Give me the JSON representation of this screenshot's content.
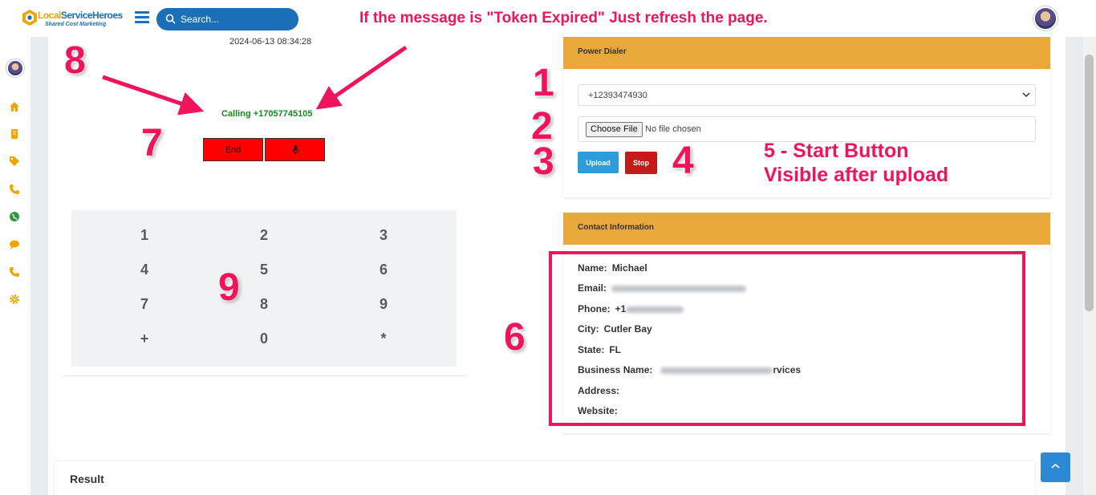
{
  "header": {
    "logo_name_part1": "Local",
    "logo_name_part2": "ServiceHeroes",
    "logo_tagline": "Shared Cost Marketing",
    "search_placeholder": "Search...",
    "banner": "If the message is \"Token Expired\" Just refresh the page."
  },
  "sidebar": {
    "icons": [
      "home-icon",
      "ledger-icon",
      "tag-icon",
      "phone-icon",
      "globe-icon",
      "chat-icon",
      "phone-icon",
      "gear-icon"
    ]
  },
  "dialer": {
    "timestamp": "2024-06-13 08:34:28",
    "status": "Calling +17057745105",
    "end_label": "End",
    "mic_icon": "microphone-icon",
    "keys": [
      "1",
      "2",
      "3",
      "4",
      "5",
      "6",
      "7",
      "8",
      "9",
      "+",
      "0",
      "*"
    ]
  },
  "power_dialer": {
    "title": "Power Dialer",
    "selected_number": "+12393474930",
    "choose_file_label": "Choose File",
    "no_file_text": "No file chosen",
    "upload_label": "Upload",
    "stop_label": "Stop"
  },
  "contact": {
    "title": "Contact Information",
    "name_label": "Name:",
    "name_value": "Michael",
    "email_label": "Email:",
    "phone_label": "Phone:",
    "phone_visible_prefix": "+1",
    "city_label": "City:",
    "city_value": "Cutler Bay",
    "state_label": "State:",
    "state_value": "FL",
    "business_label": "Business Name:",
    "business_visible_suffix": "rvices",
    "address_label": "Address:",
    "website_label": "Website:"
  },
  "annotations": {
    "n1": "1",
    "n2": "2",
    "n3": "3",
    "n4": "4",
    "n6": "6",
    "n7": "7",
    "n8": "8",
    "n9": "9",
    "note5_line1": "5 - Start Button",
    "note5_line2": "Visible after upload"
  },
  "result": {
    "title": "Result"
  },
  "colors": {
    "accent_blue": "#1b6fb8",
    "annotation_pink": "#f0145a",
    "card_header_orange": "#e8a93a",
    "end_red": "#ff0000",
    "calling_green": "#138a1e",
    "sidebar_icon_orange": "#f0a500"
  }
}
